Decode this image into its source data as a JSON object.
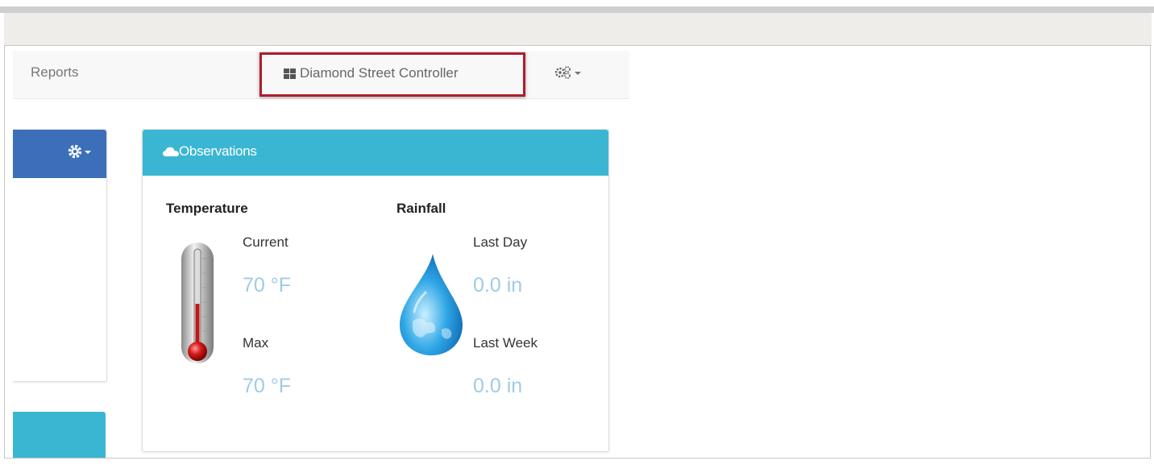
{
  "navbar": {
    "reports_label": "Reports",
    "controller_label": "Diamond Street Controller",
    "controller_icon": "grid-icon",
    "settings_icon": "gears-icon"
  },
  "observations": {
    "title": "Observations",
    "icon": "cloud-icon",
    "temperature": {
      "title": "Temperature",
      "current_label": "Current",
      "current_value": "70 °F",
      "max_label": "Max",
      "max_value": "70 °F"
    },
    "rainfall": {
      "title": "Rainfall",
      "last_day_label": "Last Day",
      "last_day_value": "0.0 in",
      "last_week_label": "Last Week",
      "last_week_value": "0.0 in"
    }
  },
  "colors": {
    "highlight_border": "#b01d2e",
    "primary_panel": "#3c6fba",
    "info_panel": "#3ab6d2",
    "value_text": "#9fcbe5"
  }
}
